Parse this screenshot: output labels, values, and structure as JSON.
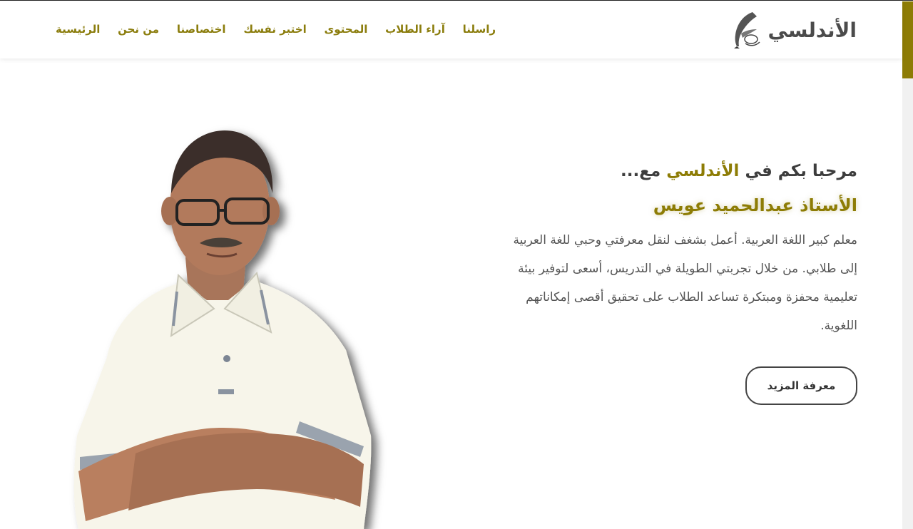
{
  "header": {
    "logo_text": "الأندلسي",
    "logo_icon": "quill-feather-icon",
    "nav": [
      {
        "label": "الرئيسية"
      },
      {
        "label": "من نحن"
      },
      {
        "label": "اختصاصنا"
      },
      {
        "label": "اختبر نفسك"
      },
      {
        "label": "المحتوى"
      },
      {
        "label": "آراء الطلاب"
      },
      {
        "label": "راسلنا"
      }
    ]
  },
  "hero": {
    "welcome_prefix": "مرحبا بكم في ",
    "welcome_brand": "الأندلسي",
    "welcome_suffix": " مع...",
    "teacher_name": "الأستاذ عبدالحميد عويس",
    "bio": "معلم كبير اللغة العربية. أعمل بشغف لنقل معرفتي وحبي للغة العربية إلى طلابي. من خلال تجربتي الطويلة في التدريس، أسعى لتوفير بيئة تعليمية محفزة ومبتكرة تساعد الطلاب على تحقيق أقصى إمكاناتهم اللغوية.",
    "more_button": "معرفة المزيد"
  },
  "colors": {
    "accent": "#8d7c05",
    "text_dark": "#3d3d3d",
    "text_body": "#555555"
  }
}
